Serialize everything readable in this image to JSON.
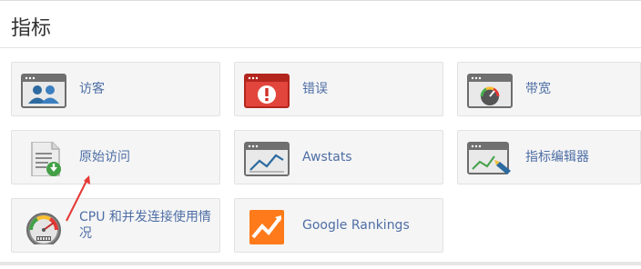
{
  "page": {
    "title": "指标"
  },
  "tiles": [
    {
      "label": "访客",
      "icon": "visitors-icon"
    },
    {
      "label": "错误",
      "icon": "error-icon"
    },
    {
      "label": "带宽",
      "icon": "bandwidth-gauge-icon"
    },
    {
      "label": "原始访问",
      "icon": "raw-access-download-icon"
    },
    {
      "label": "Awstats",
      "icon": "awstats-chart-icon"
    },
    {
      "label": "指标编辑器",
      "icon": "metrics-editor-icon"
    },
    {
      "label": "CPU 和并发连接使用情况",
      "icon": "cpu-gauge-icon"
    },
    {
      "label": "Google Rankings",
      "icon": "google-rankings-icon"
    }
  ],
  "colors": {
    "link": "#4e6ea5",
    "tile_bg": "#f5f5f5",
    "annotation_arrow": "#e53935"
  }
}
